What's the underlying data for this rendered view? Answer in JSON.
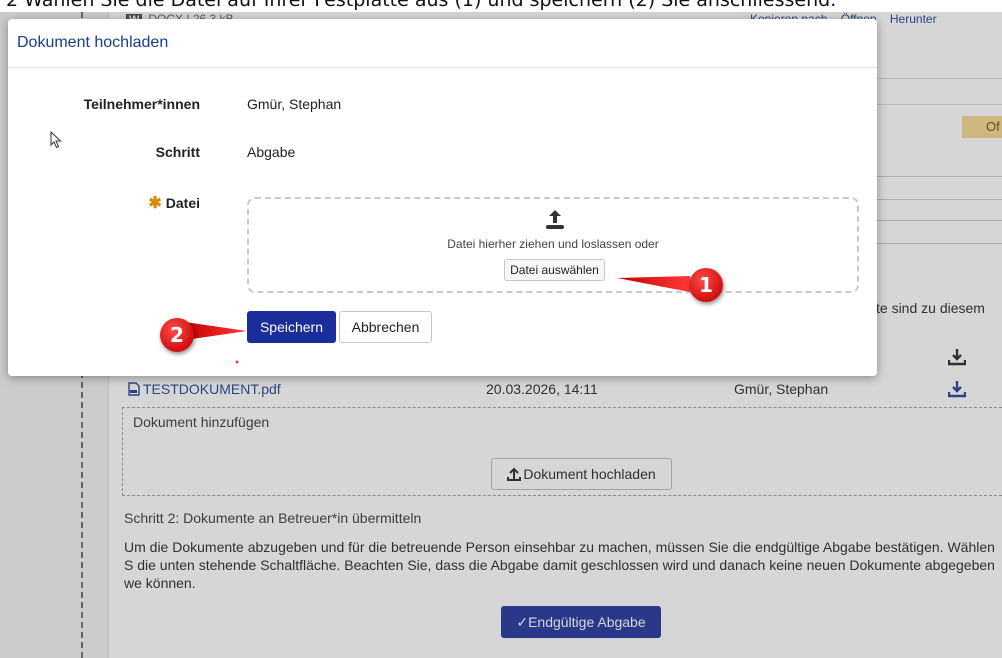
{
  "instruction": "2   Wählen Sie die Datei auf Ihrer Festplatte aus (1) und speichern (2) Sie anschliessend.",
  "background": {
    "doc_top": {
      "icon": "W",
      "meta": "DOCX | 26.3 kB"
    },
    "top_actions": [
      "Kopieren nach",
      "Öffnen",
      "Herunter"
    ],
    "badge": "Of",
    "partial_text": "te sind zu diesem",
    "file_row": {
      "name": "TESTDOKUMENT.pdf",
      "date": "20.03.2026, 14:11",
      "user": "Gmür, Stephan"
    },
    "add_label": "Dokument hinzufügen",
    "upload_button": "Dokument hochladen",
    "step2_title": "Schritt 2: Dokumente an Betreuer*in übermitteln",
    "step2_text": "Um die Dokumente abzugeben und für die betreuende Person einsehbar zu machen, müssen Sie die endgültige Abgabe bestätigen. Wählen S die unten stehende Schaltfläche. Beachten Sie, dass die Abgabe damit geschlossen wird und danach keine neuen Dokumente abgegeben we können.",
    "final_button": "Endgültige Abgabe"
  },
  "modal": {
    "title": "Dokument hochladen",
    "fields": [
      {
        "label": "Teilnehmer*innen",
        "value": "Gmür, Stephan"
      },
      {
        "label": "Schritt",
        "value": "Abgabe"
      },
      {
        "label": "Datei",
        "required": true
      }
    ],
    "dropzone": {
      "text": "Datei hierher ziehen und loslassen oder",
      "button": "Datei auswählen"
    },
    "save": "Speichern",
    "cancel": "Abbrechen"
  },
  "annotations": [
    "1",
    "2"
  ],
  "colors": {
    "primary": "#1a2d9a",
    "link": "#1a3d8f",
    "callout": "#d10f0f",
    "required": "#d98b00"
  }
}
